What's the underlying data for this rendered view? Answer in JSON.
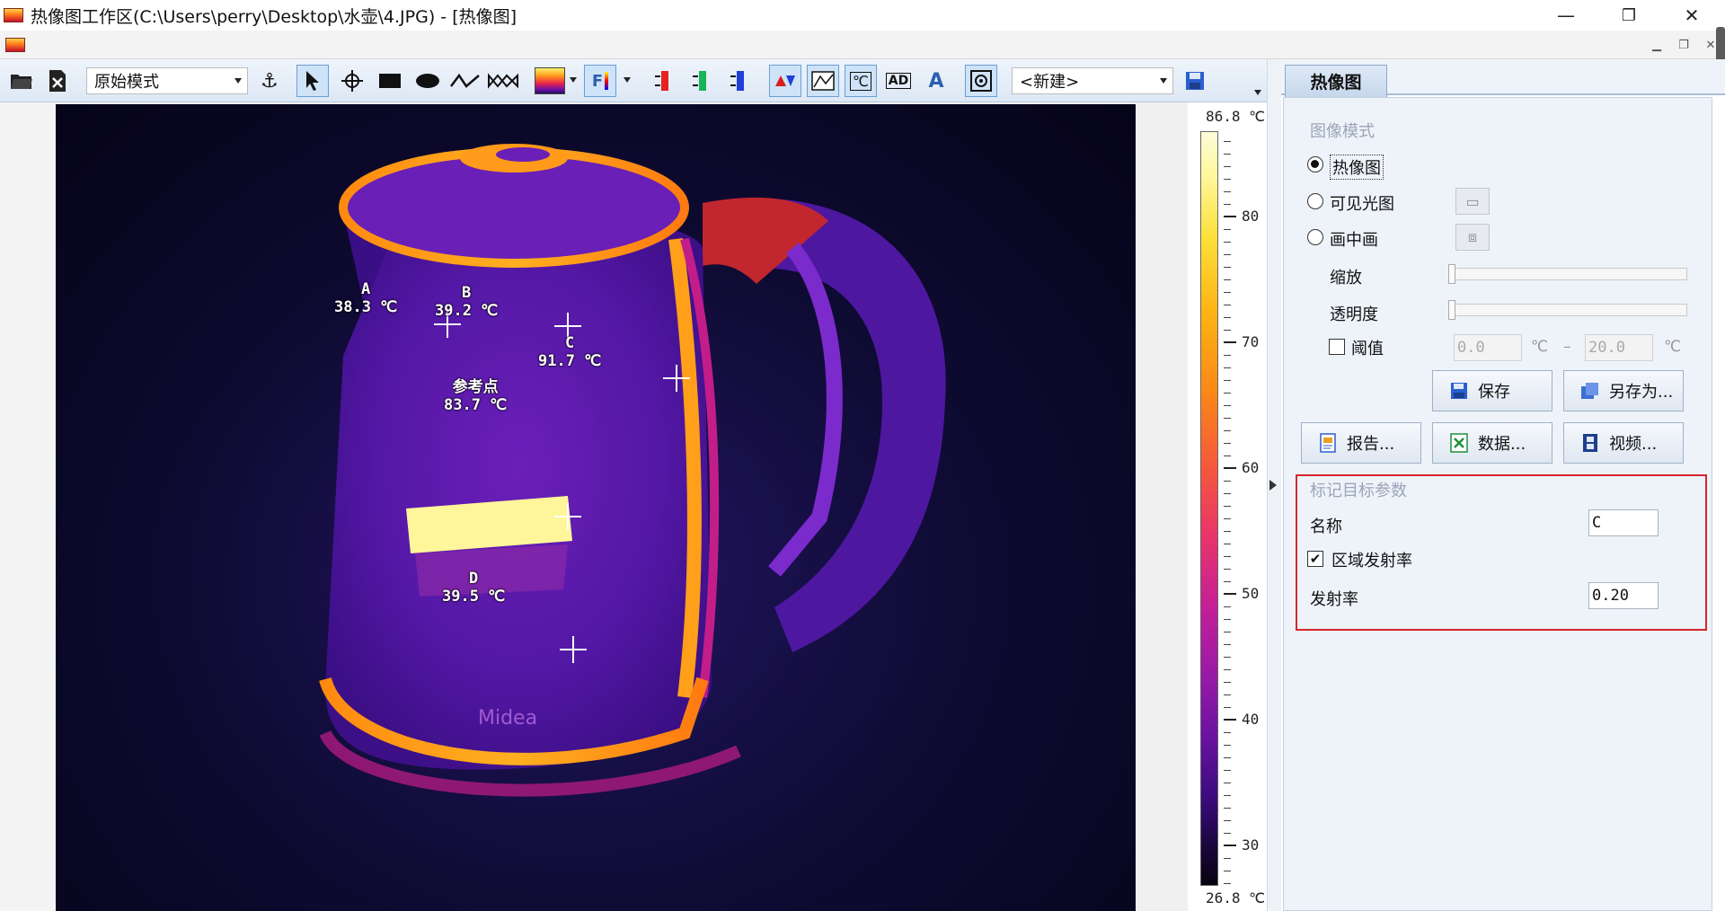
{
  "window": {
    "title": "热像图工作区(C:\\Users\\perry\\Desktop\\水壶\\4.JPG) - [热像图]",
    "minimize": "—",
    "restore": "❐",
    "close": "✕"
  },
  "toolbar": {
    "mode_combo": "原始模式",
    "preset_combo": "<新建>",
    "text_ad": "AD",
    "text_a": "A",
    "text_celsius": "℃",
    "text_f": "F"
  },
  "scale": {
    "max": "86.8 ℃",
    "min": "26.8 ℃",
    "ticks": [
      "80",
      "70",
      "60",
      "50",
      "40",
      "30"
    ]
  },
  "markers": [
    {
      "name": "A",
      "temp": "38.3 ℃"
    },
    {
      "name": "B",
      "temp": "39.2 ℃"
    },
    {
      "name": "C",
      "temp": "91.7 ℃"
    },
    {
      "name": "参考点",
      "temp": "83.7 ℃"
    },
    {
      "name": "D",
      "temp": "39.5 ℃"
    }
  ],
  "kettle_logo": "Midea",
  "panel": {
    "tab": "热像图",
    "image_mode_title": "图像模式",
    "radio_thermal": "热像图",
    "radio_visible": "可见光图",
    "radio_pip": "画中画",
    "zoom_label": "缩放",
    "opacity_label": "透明度",
    "threshold_label": "阈值",
    "threshold_low": "0.0",
    "threshold_high": "20.0",
    "unit": "℃",
    "dash": "–",
    "save_btn": "保存",
    "save_as_btn": "另存为...",
    "report_btn": "报告...",
    "data_btn": "数据...",
    "video_btn": "视频...",
    "target_title": "标记目标参数",
    "name_label": "名称",
    "name_value": "C",
    "region_emissivity_label": "区域发射率",
    "emissivity_label": "发射率",
    "emissivity_value": "0.20"
  }
}
